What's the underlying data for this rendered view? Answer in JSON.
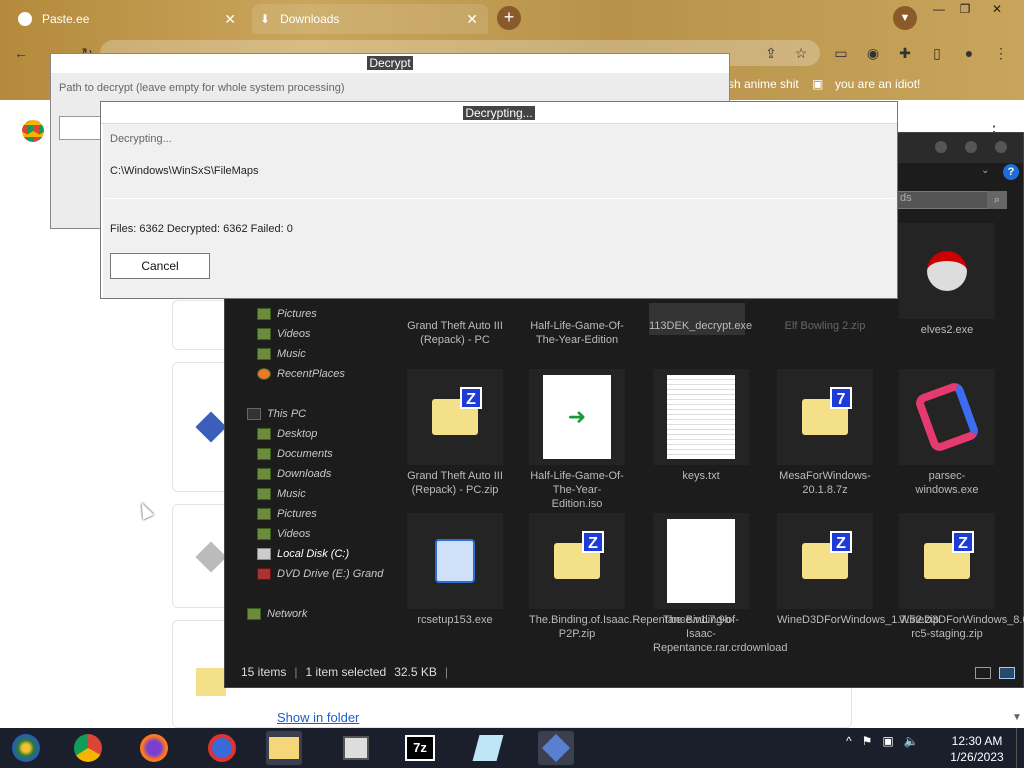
{
  "browser": {
    "tabs": [
      {
        "label": "Paste.ee"
      },
      {
        "label": "Downloads"
      }
    ],
    "bookmarks": [
      "sh anime shit",
      "you are an idiot!"
    ],
    "show_in_folder": "Show in folder"
  },
  "explorer": {
    "search_value": "ds",
    "help": "?",
    "nav": {
      "libraries": [
        "Pictures",
        "Videos",
        "Music",
        "RecentPlaces"
      ],
      "this_pc_label": "This PC",
      "this_pc": [
        "Desktop",
        "Documents",
        "Downloads",
        "Music",
        "Pictures",
        "Videos",
        "Local Disk (C:)",
        "DVD Drive (E:) Grand"
      ],
      "network": "Network"
    },
    "files": [
      {
        "name": "Grand Theft Auto III (Repack) - PC",
        "icon": "folder-green-icon"
      },
      {
        "name": "Half-Life-Game-Of-The-Year-Edition",
        "icon": "folder-green-icon"
      },
      {
        "name": "113DEK_decrypt.exe",
        "icon": "gear-app-icon"
      },
      {
        "name": "Elf Bowling 2.zip",
        "icon": "zip-icon"
      },
      {
        "name": "elves2.exe",
        "icon": "elf-icon"
      },
      {
        "name": "Grand Theft Auto III (Repack) - PC.zip",
        "icon": "zip-icon"
      },
      {
        "name": "Half-Life-Game-Of-The-Year-Edition.iso",
        "icon": "iso-icon"
      },
      {
        "name": "keys.txt",
        "icon": "text-file-icon"
      },
      {
        "name": "MesaForWindows-20.1.8.7z",
        "icon": "7z-icon"
      },
      {
        "name": "parsec-windows.exe",
        "icon": "parsec-icon"
      },
      {
        "name": "rcsetup153.exe",
        "icon": "setup-icon"
      },
      {
        "name": "The.Binding.of.Isaac.Repentance.v1.7.9b-P2P.zip",
        "icon": "zip-icon"
      },
      {
        "name": "The-Binding-of-Isaac-Repentance.rar.crdownload",
        "icon": "blank-file-icon"
      },
      {
        "name": "WineD3DForWindows_1.7.52.zip",
        "icon": "zip-icon"
      },
      {
        "name": "WineD3DForWindows_8.0-rc5-staging.zip",
        "icon": "zip-icon"
      }
    ],
    "status": {
      "items": "15 items",
      "selected": "1 item selected",
      "size": "32.5 KB"
    }
  },
  "dialog_back": {
    "title": "Decrypt",
    "label": "Path to decrypt (leave empty for whole system processing)"
  },
  "dialog_front": {
    "title": "Decrypting...",
    "status": "Decrypting...",
    "path": "C:\\Windows\\WinSxS\\FileMaps",
    "counts": "Files: 6362 Decrypted: 6362 Failed: 0",
    "cancel": "Cancel"
  },
  "taskbar": {
    "time": "12:30 AM",
    "date": "1/26/2023",
    "apps": [
      "windows-start-icon",
      "chrome-icon",
      "firefox-icon",
      "opera-icon",
      "explorer-icon",
      "archive-icon",
      "7zip-icon",
      "pencil-app-icon",
      "decrypt-app-icon"
    ]
  }
}
